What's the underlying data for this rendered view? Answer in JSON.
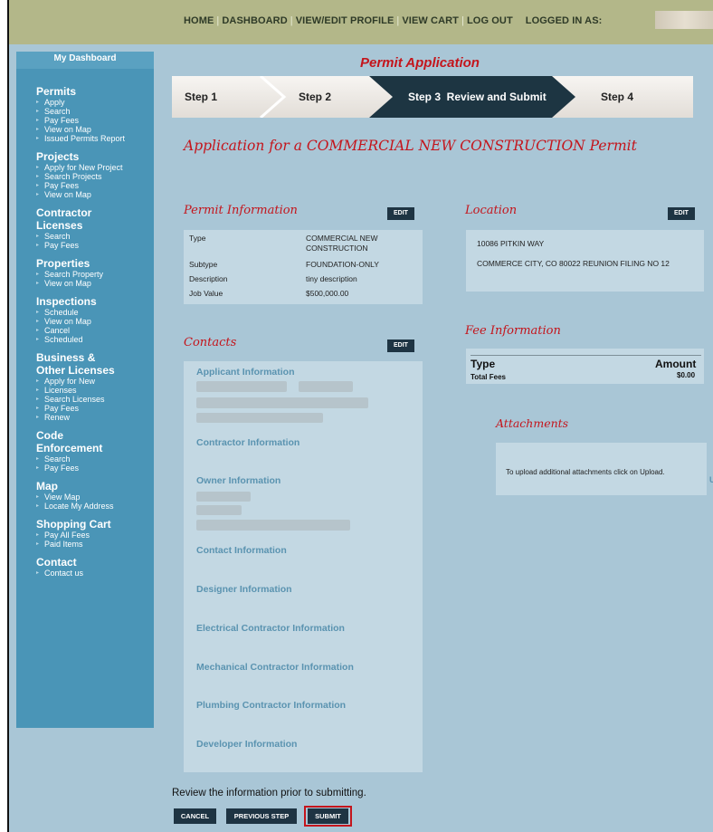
{
  "topnav": {
    "home": "HOME",
    "dashboard": "DASHBOARD",
    "profile": "VIEW/EDIT PROFILE",
    "cart": "VIEW CART",
    "logout": "LOG OUT",
    "logged_in_label": "LOGGED IN AS:"
  },
  "sidebar": {
    "dashboard": "My Dashboard",
    "sections": [
      {
        "title": [
          "Permits"
        ],
        "items": [
          "Apply",
          "Search",
          "Pay Fees",
          "View on Map",
          "Issued Permits Report"
        ]
      },
      {
        "title": [
          "Projects"
        ],
        "items": [
          "Apply for New Project",
          "Search Projects",
          "Pay Fees",
          "View on Map"
        ]
      },
      {
        "title": [
          "Contractor",
          "Licenses"
        ],
        "items": [
          "Search",
          "Pay Fees"
        ]
      },
      {
        "title": [
          "Properties"
        ],
        "items": [
          "Search Property",
          "View on Map"
        ]
      },
      {
        "title": [
          "Inspections"
        ],
        "items": [
          "Schedule",
          "View on Map",
          "Cancel",
          "Scheduled"
        ]
      },
      {
        "title": [
          "Business &",
          "Other Licenses"
        ],
        "items": [
          "Apply for New",
          "Licenses",
          "Search Licenses",
          "Pay Fees",
          "Renew"
        ]
      },
      {
        "title": [
          "Code",
          "Enforcement"
        ],
        "items": [
          "Search",
          "Pay Fees"
        ]
      },
      {
        "title": [
          "Map"
        ],
        "items": [
          "View Map",
          "Locate My Address"
        ]
      },
      {
        "title": [
          "Shopping Cart"
        ],
        "items": [
          "Pay All Fees",
          "Paid Items"
        ]
      },
      {
        "title": [
          "Contact"
        ],
        "items": [
          "Contact us"
        ]
      }
    ]
  },
  "main": {
    "page_title": "Permit Application",
    "steps": [
      "Step 1",
      "Step 2",
      "Step 3  Review and Submit",
      "Step 4"
    ],
    "app_title": "Application for a COMMERCIAL NEW CONSTRUCTION Permit",
    "edit_label": "EDIT",
    "permit_info": {
      "heading": "Permit Information",
      "type_label": "Type",
      "type_value_line1": "COMMERCIAL NEW",
      "type_value_line2": "CONSTRUCTION",
      "subtype_label": "Subtype",
      "subtype_value": "FOUNDATION-ONLY",
      "description_label": "Description",
      "description_value": "tiny description",
      "job_value_label": "Job Value",
      "job_value_value": "$500,000.00"
    },
    "location": {
      "heading": "Location",
      "address1": "10086 PITKIN WAY",
      "address2": "COMMERCE CITY, CO 80022 REUNION FILING NO 12"
    },
    "contacts": {
      "heading": "Contacts",
      "sections": [
        "Applicant Information",
        "Contractor Information",
        "Owner Information",
        "Contact Information",
        "Designer Information",
        "Electrical Contractor Information",
        "Mechanical Contractor Information",
        "Plumbing Contractor Information",
        "Developer Information"
      ]
    },
    "fee_info": {
      "heading": "Fee Information",
      "type_header": "Type",
      "amount_header": "Amount",
      "total_label": "Total Fees",
      "total_value": "$0.00"
    },
    "attachments": {
      "heading": "Attachments",
      "text": "To upload additional attachments click on Upload.",
      "upload_fragment": "U"
    },
    "review_text": "Review the information prior to submitting.",
    "buttons": {
      "cancel": "CANCEL",
      "previous": "PREVIOUS STEP",
      "submit": "SUBMIT"
    }
  },
  "colors": {
    "accent_red": "#c4151c",
    "sidebar_blue": "#4a95b7",
    "dark_button": "#1e3443",
    "page_bg": "#a9c6d6"
  }
}
